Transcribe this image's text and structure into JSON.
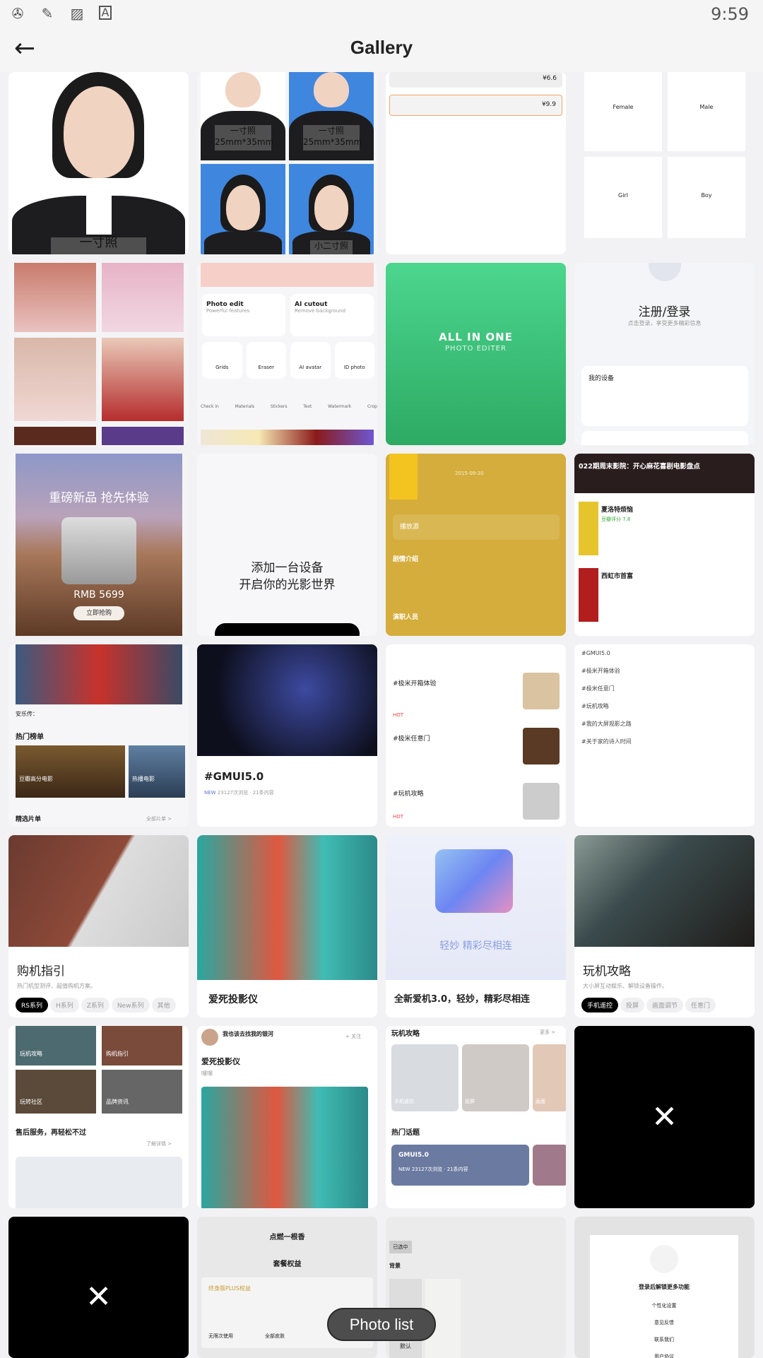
{
  "status_bar": {
    "time": "9:59",
    "icons": [
      "sync-icon",
      "sketch-icon",
      "image-icon",
      "font-icon"
    ]
  },
  "header": {
    "title": "Gallery",
    "back_icon": "arrow-left-icon"
  },
  "tiles": {
    "t1": {
      "label": "一寸照"
    },
    "t2": {
      "a": "一寸照",
      "a2": "25mm*35mm",
      "b": "一寸照",
      "b2": "25mm*35mm",
      "d": "小二寸照"
    },
    "t3": {
      "p1": "¥6.6",
      "p2": "¥9.9"
    },
    "t4": {
      "items": [
        "Female",
        "Male",
        "Girl",
        "Boy"
      ]
    },
    "t6": {
      "edit": "Photo edit",
      "edit_sub": "Powerful features",
      "cut": "AI cutout",
      "cut_sub": "Remove background",
      "tools": [
        "Grids",
        "Eraser",
        "AI avatar",
        "ID photo"
      ],
      "small": [
        "Check in",
        "Materials",
        "Stickers",
        "Text",
        "Watermark",
        "Crop"
      ]
    },
    "t7": {
      "title": "ALL IN ONE",
      "sub": "PHOTO EDITER",
      "color": "#3cc67e"
    },
    "t8": {
      "title": "注册/登录",
      "sub": "点击登录，享受更多精彩信息",
      "section": "我的设备"
    },
    "t9": {
      "title": "重磅新品 抢先体验",
      "price": "RMB 5699",
      "btn": "立即抢购"
    },
    "t10": {
      "l1": "添加一台设备",
      "l2": "开启你的光影世界"
    },
    "t11": {
      "date": "2015-09-30",
      "source": "播放源",
      "plot": "剧情介绍",
      "cast": "演职人员",
      "color": "#d4ad3c"
    },
    "t12": {
      "title": "022期周末影院：开心麻花喜剧电影盘点",
      "m1": "夏洛特烦恼",
      "score": "豆瓣评分 7.8",
      "m2": "西虹市首富"
    },
    "t13": {
      "caption": "安乐传：",
      "hot": "热门榜单",
      "c1": "豆瓣高分电影",
      "c2": "热播电影",
      "picks": "精选片单",
      "all": "全部片单 >"
    },
    "t14": {
      "title": "#GMUI5.0",
      "badge": "NEW",
      "meta": "23127次浏览 · 21条内容"
    },
    "t15": {
      "items": [
        {
          "t": "#极米开箱体验",
          "badge": "HOT"
        },
        {
          "t": "#极米任意门",
          "badge": ""
        },
        {
          "t": "#玩机攻略",
          "badge": "HOT"
        }
      ]
    },
    "t16": {
      "items": [
        "#GMUI5.0",
        "#极米开箱体验",
        "#极米任意门",
        "#玩机攻略",
        "#我的大屏观影之路",
        "#关于家的诗人时间"
      ]
    },
    "t17": {
      "title": "购机指引",
      "sub": "热门机型测评、超值购机方案。",
      "pills": [
        "RS系列",
        "H系列",
        "Z系列",
        "New系列",
        "其他"
      ]
    },
    "t18": {
      "title": "爱死投影仪"
    },
    "t19": {
      "art": "轻妙 精彩尽相连",
      "title": "全新爱机3.0，轻妙，精彩尽相连"
    },
    "t20": {
      "title": "玩机攻略",
      "sub": "大小屏互动娱乐、解锁设备操作。",
      "pills": [
        "手机遥控",
        "投屏",
        "画面调节",
        "任意门"
      ]
    },
    "t21": {
      "cells": [
        "玩机攻略",
        "购机指引",
        "玩转社区",
        "品牌资讯"
      ],
      "title": "售后服务，再轻松不过",
      "more": "了解详情 >"
    },
    "t22": {
      "user": "我也该去找我的银河",
      "follow": "+ 关注",
      "title": "爱死投影仪",
      "text": "嘿嘿"
    },
    "t23": {
      "s1": "玩机攻略",
      "more": "更多 >",
      "cells": [
        "手机遥控",
        "投屏",
        "画面"
      ],
      "s2": "热门话题",
      "card": "GMUI5.0",
      "badge": "NEW",
      "meta": "23127次浏览 · 21条内容"
    },
    "t26": {
      "title": "点燃一根香",
      "section": "套餐权益",
      "plus": "终身版PLUS权益",
      "f1": "无限次使用",
      "f2": "全部皮肤"
    },
    "t27": {
      "sel": "已选中",
      "bg": "背景",
      "def": "默认"
    },
    "t28": {
      "title": "登录后解锁更多功能",
      "items": [
        "个性化设置",
        "意见反馈",
        "联系我们",
        "用户协议"
      ]
    }
  },
  "photo_list_button": "Photo list"
}
